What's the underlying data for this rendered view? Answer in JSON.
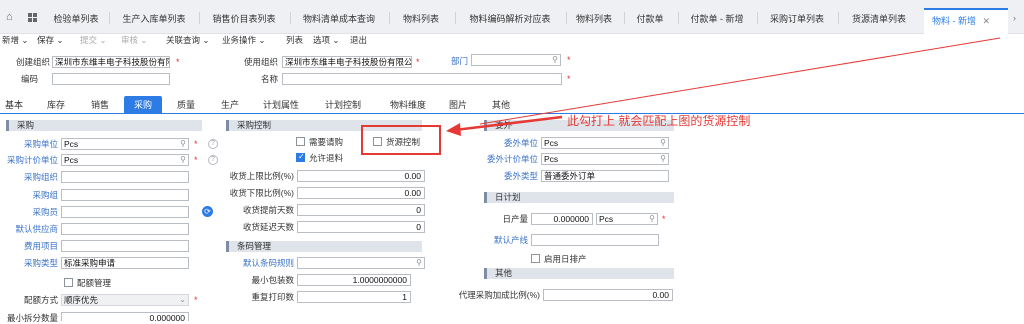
{
  "tabs": [
    {
      "label": "检验单列表"
    },
    {
      "label": "生产入库单列表"
    },
    {
      "label": "销售价目表列表"
    },
    {
      "label": "物料清单成本查询"
    },
    {
      "label": "物料列表"
    },
    {
      "label": "物料编码解析对应表"
    },
    {
      "label": "物料列表"
    },
    {
      "label": "付款单"
    },
    {
      "label": "付款单 - 新增"
    },
    {
      "label": "采购订单列表"
    },
    {
      "label": "货源清单列表"
    },
    {
      "label": "物料 - 新增"
    }
  ],
  "toolbar": {
    "new": "新增",
    "save": "保存",
    "submit": "提交",
    "audit": "审核",
    "related": "关联查询",
    "ops": "业务操作",
    "list": "列表",
    "options": "选项",
    "exit": "退出"
  },
  "header": {
    "create_org_label": "创建组织",
    "create_org_value": "深圳市东维丰电子科技股份有限",
    "use_org_label": "使用组织",
    "use_org_value": "深圳市东维丰电子科技股份有限公",
    "dept_label": "部门",
    "code_label": "编码",
    "name_label": "名称"
  },
  "subtabs": [
    {
      "label": "基本"
    },
    {
      "label": "库存"
    },
    {
      "label": "销售"
    },
    {
      "label": "采购"
    },
    {
      "label": "质量"
    },
    {
      "label": "生产"
    },
    {
      "label": "计划属性"
    },
    {
      "label": "计划控制"
    },
    {
      "label": "物料维度"
    },
    {
      "label": "图片"
    },
    {
      "label": "其他"
    }
  ],
  "purchase": {
    "title": "采购",
    "unit_label": "采购单位",
    "unit_value": "Pcs",
    "price_unit_label": "采购计价单位",
    "price_unit_value": "Pcs",
    "org_label": "采购组织",
    "group_label": "采购组",
    "buyer_label": "采购员",
    "vendor_label": "默认供应商",
    "expense_label": "费用项目",
    "type_label": "采购类型",
    "type_value": "标准采购申请",
    "quota_label": "配额管理",
    "quota_mode_label": "配额方式",
    "quota_mode_value": "顺序优先",
    "min_split_label": "最小拆分数量",
    "min_split_value": "0.000000"
  },
  "control": {
    "title": "采购控制",
    "need_request": "需要请购",
    "source_control": "货源控制",
    "allow_return": "允许退料",
    "upper_label": "收货上限比例(%)",
    "upper_value": "0.00",
    "lower_label": "收货下限比例(%)",
    "lower_value": "0.00",
    "advance_label": "收货提前天数",
    "advance_value": "0",
    "delay_label": "收货延迟天数",
    "delay_value": "0"
  },
  "barcode": {
    "title": "条码管理",
    "rule_label": "默认条码规则",
    "min_pack_label": "最小包装数",
    "min_pack_value": "1.0000000000",
    "reprint_label": "重复打印数",
    "reprint_value": "1"
  },
  "outsource": {
    "title": "委外",
    "unit_label": "委外单位",
    "unit_value": "Pcs",
    "price_unit_label": "委外计价单位",
    "price_unit_value": "Pcs",
    "type_label": "委外类型",
    "type_value": "普通委外订单"
  },
  "daily": {
    "title": "日计划",
    "output_label": "日产量",
    "output_value": "0.000000",
    "output_unit": "Pcs",
    "line_label": "默认产线",
    "use_daily_label": "启用日排产"
  },
  "other": {
    "title": "其他",
    "agent_label": "代理采购加成比例(%)",
    "agent_value": "0.00"
  },
  "annotation": "此勾打上 就会匹配上图的货源控制",
  "colors": {
    "accent": "#2d7be5",
    "annotation": "#e53935"
  }
}
